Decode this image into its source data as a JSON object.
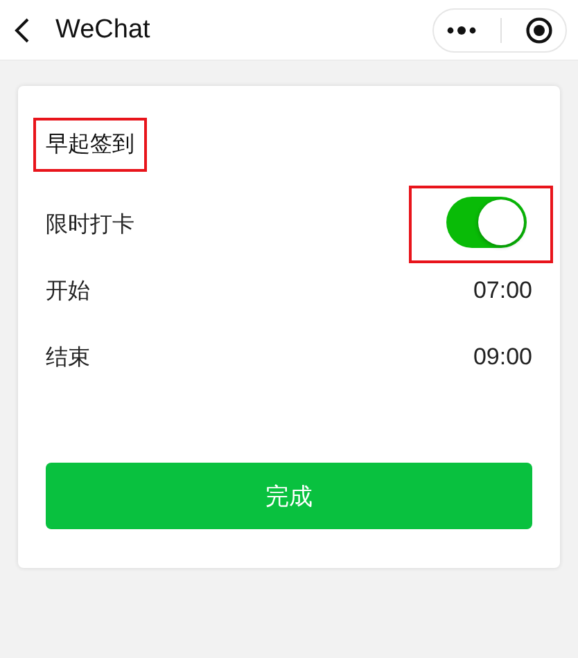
{
  "nav": {
    "title": "WeChat"
  },
  "card": {
    "title": {
      "text": "早起签到",
      "highlighted": true
    },
    "rows": [
      {
        "kind": "switch",
        "label": "限时打卡",
        "on": true,
        "highlighted": true
      },
      {
        "kind": "value",
        "label": "开始",
        "value": "07:00"
      },
      {
        "kind": "value",
        "label": "结束",
        "value": "09:00"
      }
    ],
    "button": "完成"
  }
}
